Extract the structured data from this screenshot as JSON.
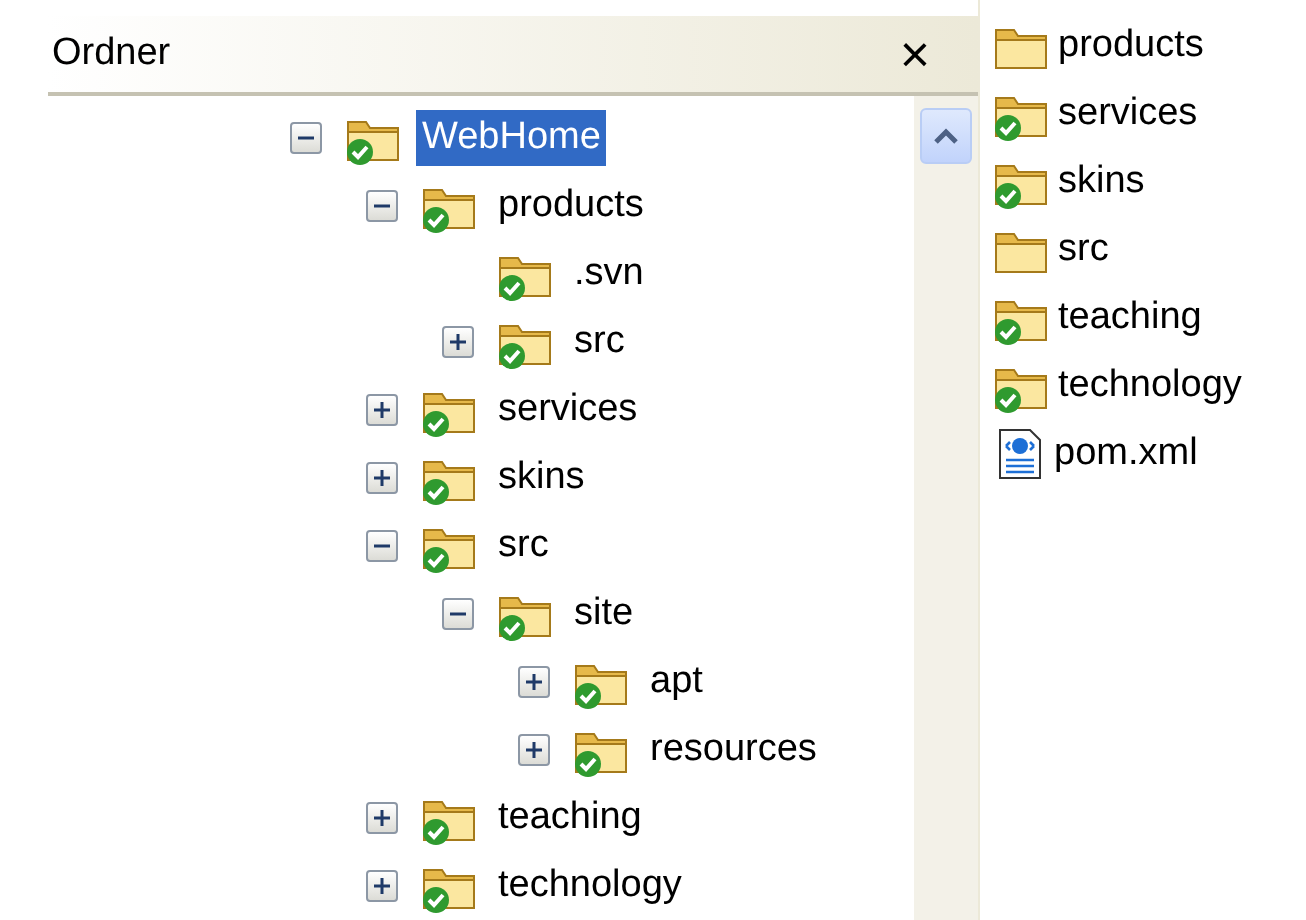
{
  "folder_pane": {
    "title": "Ordner",
    "close": "×",
    "tree": [
      {
        "label": "WebHome",
        "versioned": true,
        "expanded": true,
        "selected": true,
        "children": [
          {
            "label": "products",
            "versioned": true,
            "expanded": true,
            "selected": false,
            "children": [
              {
                "label": ".svn",
                "versioned": true,
                "selected": false
              },
              {
                "label": "src",
                "versioned": true,
                "expanded": false,
                "selected": false
              }
            ]
          },
          {
            "label": "services",
            "versioned": true,
            "expanded": false,
            "selected": false
          },
          {
            "label": "skins",
            "versioned": true,
            "expanded": false,
            "selected": false
          },
          {
            "label": "src",
            "versioned": true,
            "expanded": true,
            "selected": false,
            "children": [
              {
                "label": "site",
                "versioned": true,
                "expanded": true,
                "selected": false,
                "children": [
                  {
                    "label": "apt",
                    "versioned": true,
                    "expanded": false,
                    "selected": false
                  },
                  {
                    "label": "resources",
                    "versioned": true,
                    "expanded": false,
                    "selected": false
                  }
                ]
              }
            ]
          },
          {
            "label": "teaching",
            "versioned": true,
            "expanded": false,
            "selected": false
          },
          {
            "label": "technology",
            "versioned": true,
            "expanded": false,
            "selected": false
          }
        ]
      }
    ]
  },
  "file_list": [
    {
      "kind": "folder",
      "label": "products",
      "versioned": false
    },
    {
      "kind": "folder",
      "label": "services",
      "versioned": true
    },
    {
      "kind": "folder",
      "label": "skins",
      "versioned": true
    },
    {
      "kind": "folder",
      "label": "src",
      "versioned": false
    },
    {
      "kind": "folder",
      "label": "teaching",
      "versioned": true
    },
    {
      "kind": "folder",
      "label": "technology",
      "versioned": true
    },
    {
      "kind": "xml",
      "label": "pom.xml"
    }
  ]
}
